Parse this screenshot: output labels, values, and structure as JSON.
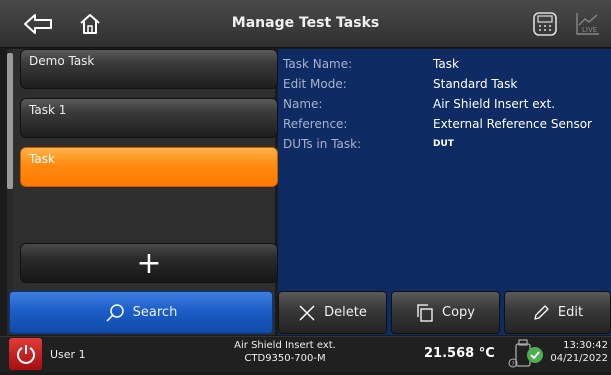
{
  "header": {
    "title": "Manage Test Tasks",
    "back_icon": "back-arrow-icon",
    "home_icon": "home-icon",
    "calculator_icon": "calculator-icon",
    "live_icon": "live-chart-icon",
    "live_label": "LIVE"
  },
  "tasks": {
    "items": [
      {
        "label": "Demo Task",
        "selected": false
      },
      {
        "label": "Task 1",
        "selected": false
      },
      {
        "label": "Task",
        "selected": true
      }
    ],
    "add_label": "+"
  },
  "details": {
    "rows": [
      {
        "key": "Task Name:",
        "value": "Task"
      },
      {
        "key": "Edit Mode:",
        "value": "Standard Task"
      },
      {
        "key": "Name:",
        "value": "Air Shield Insert ext."
      },
      {
        "key": "Reference:",
        "value": "External Reference Sensor"
      },
      {
        "key": "DUTs in Task:",
        "value": "DUT"
      }
    ]
  },
  "actions": {
    "search": "Search",
    "delete": "Delete",
    "copy": "Copy",
    "edit": "Edit"
  },
  "status": {
    "user": "User 1",
    "device_name": "Air Shield Insert ext.",
    "device_model": "CTD9350-700-M",
    "temperature": "21.568 °C",
    "time": "13:30:42",
    "date": "04/21/2022"
  },
  "colors": {
    "accent_orange": "#ff8a10",
    "details_bg": "#0e2b63",
    "search_blue": "#1c5ec8",
    "power_red": "#c21f1f",
    "status_green": "#4caf50"
  }
}
